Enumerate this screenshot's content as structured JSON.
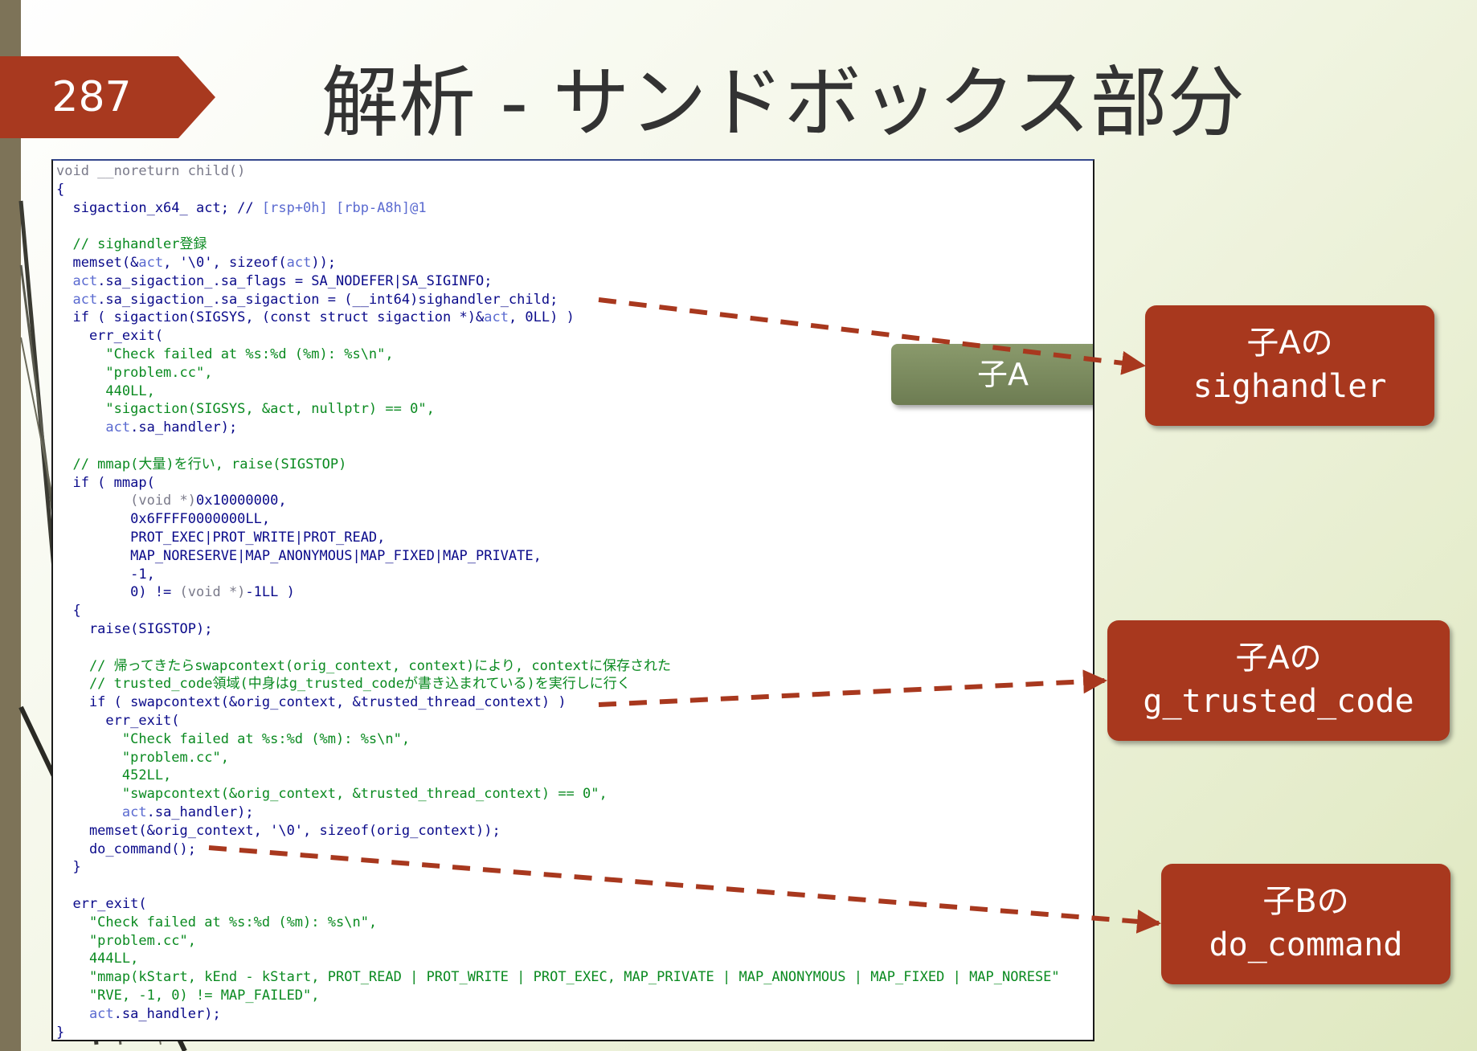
{
  "slide": {
    "page_number": "287",
    "title": "解析 - サンドボックス部分",
    "tag_label": "子A"
  },
  "callouts": [
    {
      "line1": "子Aの",
      "line2": "sighandler"
    },
    {
      "line1": "子Aの",
      "line2": "g_trusted_code"
    },
    {
      "line1": "子Bの",
      "line2": "do_command"
    }
  ],
  "colors": {
    "accent_red": "#a8381e",
    "tag_green": "#7b8a5f",
    "left_bar": "#7d7358",
    "code_keyword": "#0a0a8a",
    "code_comment": "#0a8a20",
    "code_gray": "#7a7a8a",
    "code_var": "#5a6ad0"
  },
  "code": [
    {
      "spans": [
        {
          "t": "void __noreturn child()",
          "c": "g"
        }
      ]
    },
    {
      "spans": [
        {
          "t": "{",
          "c": "k"
        }
      ]
    },
    {
      "spans": [
        {
          "t": "  sigaction_x64_ act; // ",
          "c": "k"
        },
        {
          "t": "[rsp+0h] [rbp-A8h]@1",
          "c": "v"
        }
      ]
    },
    {
      "spans": [
        {
          "t": "",
          "c": "k"
        }
      ]
    },
    {
      "spans": [
        {
          "t": "  // sighandler登録",
          "c": "c"
        }
      ]
    },
    {
      "spans": [
        {
          "t": "  memset(&",
          "c": "k"
        },
        {
          "t": "act",
          "c": "v"
        },
        {
          "t": ", '\\0', sizeof(",
          "c": "k"
        },
        {
          "t": "act",
          "c": "v"
        },
        {
          "t": "));",
          "c": "k"
        }
      ]
    },
    {
      "spans": [
        {
          "t": "  act",
          "c": "v"
        },
        {
          "t": ".sa_sigaction_.sa_flags = SA_NODEFER|SA_SIGINFO;",
          "c": "k"
        }
      ]
    },
    {
      "spans": [
        {
          "t": "  act",
          "c": "v"
        },
        {
          "t": ".sa_sigaction_.sa_sigaction = (__int64)sighandler_child;",
          "c": "k"
        }
      ]
    },
    {
      "spans": [
        {
          "t": "  if ( sigaction(SIGSYS, (const struct sigaction *)&",
          "c": "k"
        },
        {
          "t": "act",
          "c": "v"
        },
        {
          "t": ", 0LL) )",
          "c": "k"
        }
      ]
    },
    {
      "spans": [
        {
          "t": "    err_exit(",
          "c": "k"
        }
      ]
    },
    {
      "spans": [
        {
          "t": "      \"Check failed at %s:%d (%m): %s\\n\",",
          "c": "c"
        }
      ]
    },
    {
      "spans": [
        {
          "t": "      \"problem.cc\",",
          "c": "c"
        }
      ]
    },
    {
      "spans": [
        {
          "t": "      440LL,",
          "c": "c"
        }
      ]
    },
    {
      "spans": [
        {
          "t": "      \"sigaction(SIGSYS, &act, nullptr) == 0\",",
          "c": "c"
        }
      ]
    },
    {
      "spans": [
        {
          "t": "      act",
          "c": "v"
        },
        {
          "t": ".sa_handler);",
          "c": "k"
        }
      ]
    },
    {
      "spans": [
        {
          "t": "",
          "c": "k"
        }
      ]
    },
    {
      "spans": [
        {
          "t": "  // mmap(大量)を行い, raise(SIGSTOP)",
          "c": "c"
        }
      ]
    },
    {
      "spans": [
        {
          "t": "  if ( mmap(",
          "c": "k"
        }
      ]
    },
    {
      "spans": [
        {
          "t": "         (void *)",
          "c": "g"
        },
        {
          "t": "0x10000000,",
          "c": "k"
        }
      ]
    },
    {
      "spans": [
        {
          "t": "         0x6FFFF0000000LL,",
          "c": "k"
        }
      ]
    },
    {
      "spans": [
        {
          "t": "         PROT_EXEC|PROT_WRITE|PROT_READ,",
          "c": "k"
        }
      ]
    },
    {
      "spans": [
        {
          "t": "         MAP_NORESERVE|MAP_ANONYMOUS|MAP_FIXED|MAP_PRIVATE,",
          "c": "k"
        }
      ]
    },
    {
      "spans": [
        {
          "t": "         -1,",
          "c": "k"
        }
      ]
    },
    {
      "spans": [
        {
          "t": "         0) != ",
          "c": "k"
        },
        {
          "t": "(void *)",
          "c": "g"
        },
        {
          "t": "-1LL )",
          "c": "k"
        }
      ]
    },
    {
      "spans": [
        {
          "t": "  {",
          "c": "k"
        }
      ]
    },
    {
      "spans": [
        {
          "t": "    raise(SIGSTOP);",
          "c": "k"
        }
      ]
    },
    {
      "spans": [
        {
          "t": "",
          "c": "k"
        }
      ]
    },
    {
      "spans": [
        {
          "t": "    // 帰ってきたらswapcontext(orig_context, context)により, contextに保存された",
          "c": "c"
        }
      ]
    },
    {
      "spans": [
        {
          "t": "    // trusted_code領域(中身はg_trusted_codeが書き込まれている)を実行しに行く",
          "c": "c"
        }
      ]
    },
    {
      "spans": [
        {
          "t": "    if ( swapcontext(&orig_context, &trusted_thread_context) )",
          "c": "k"
        }
      ]
    },
    {
      "spans": [
        {
          "t": "      err_exit(",
          "c": "k"
        }
      ]
    },
    {
      "spans": [
        {
          "t": "        \"Check failed at %s:%d (%m): %s\\n\",",
          "c": "c"
        }
      ]
    },
    {
      "spans": [
        {
          "t": "        \"problem.cc\",",
          "c": "c"
        }
      ]
    },
    {
      "spans": [
        {
          "t": "        452LL,",
          "c": "c"
        }
      ]
    },
    {
      "spans": [
        {
          "t": "        \"swapcontext(&orig_context, &trusted_thread_context) == 0\",",
          "c": "c"
        }
      ]
    },
    {
      "spans": [
        {
          "t": "        act",
          "c": "v"
        },
        {
          "t": ".sa_handler);",
          "c": "k"
        }
      ]
    },
    {
      "spans": [
        {
          "t": "    memset(&orig_context, '\\0', sizeof(orig_context));",
          "c": "k"
        }
      ]
    },
    {
      "spans": [
        {
          "t": "    do_command();",
          "c": "k"
        }
      ]
    },
    {
      "spans": [
        {
          "t": "  }",
          "c": "k"
        }
      ]
    },
    {
      "spans": [
        {
          "t": "",
          "c": "k"
        }
      ]
    },
    {
      "spans": [
        {
          "t": "  err_exit(",
          "c": "k"
        }
      ]
    },
    {
      "spans": [
        {
          "t": "    \"Check failed at %s:%d (%m): %s\\n\",",
          "c": "c"
        }
      ]
    },
    {
      "spans": [
        {
          "t": "    \"problem.cc\",",
          "c": "c"
        }
      ]
    },
    {
      "spans": [
        {
          "t": "    444LL,",
          "c": "c"
        }
      ]
    },
    {
      "spans": [
        {
          "t": "    \"mmap(kStart, kEnd - kStart, PROT_READ | PROT_WRITE | PROT_EXEC, MAP_PRIVATE | MAP_ANONYMOUS | MAP_FIXED | MAP_NORESE\"",
          "c": "c"
        }
      ]
    },
    {
      "spans": [
        {
          "t": "    \"RVE, -1, 0) != MAP_FAILED\",",
          "c": "c"
        }
      ]
    },
    {
      "spans": [
        {
          "t": "    act",
          "c": "v"
        },
        {
          "t": ".sa_handler);",
          "c": "k"
        }
      ]
    },
    {
      "spans": [
        {
          "t": "}",
          "c": "k"
        }
      ]
    }
  ]
}
